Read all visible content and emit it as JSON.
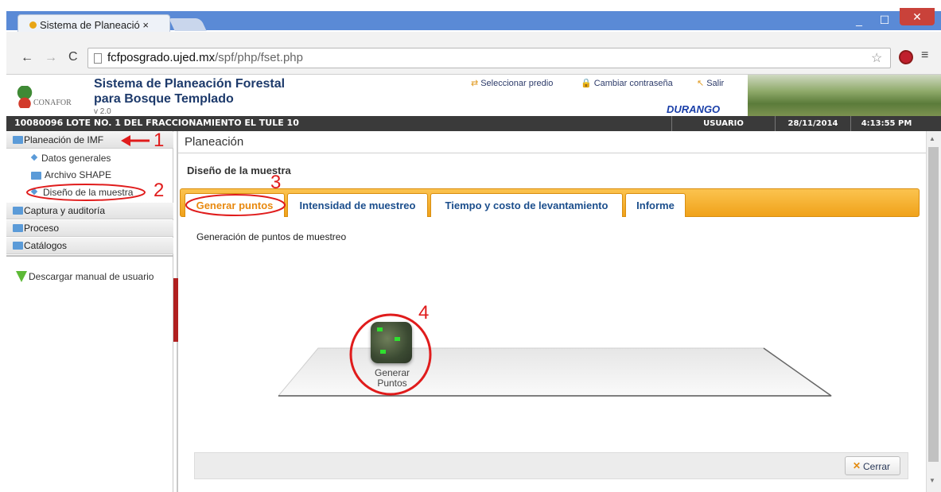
{
  "browser": {
    "tab_title": "Sistema de Planeació ×",
    "url_host": "fcfposgrado.ujed.mx",
    "url_path": "/spf/php/fset.php",
    "min_glyph": "_",
    "max_glyph": "☐",
    "close_glyph": "✕"
  },
  "app": {
    "title_line1": "Sistema de Planeación Forestal",
    "title_line2": "para Bosque Templado",
    "version": "v 2.0",
    "logo_text": "CONAFOR",
    "links": {
      "predio": "Seleccionar predio",
      "password": "Cambiar contraseña",
      "salir": "Salir"
    },
    "region": "DURANGO"
  },
  "status": {
    "predio": "10080096 LOTE NO. 1 DEL FRACCIONAMIENTO EL TULE 10",
    "user": "USUARIO",
    "date": "28/11/2014",
    "time": "4:13:55 PM"
  },
  "sidebar": {
    "planeacion": "Planeación de IMF",
    "items": [
      {
        "label": "Datos generales"
      },
      {
        "label": "Archivo SHAPE"
      },
      {
        "label": "Diseño de la muestra"
      }
    ],
    "captura": "Captura y auditoría",
    "proceso": "Proceso",
    "catalogos": "Catálogos",
    "download": "Descargar manual de usuario"
  },
  "main": {
    "header": "Planeación",
    "section_title": "Diseño de la muestra",
    "tabs": [
      {
        "label": "Generar puntos"
      },
      {
        "label": "Intensidad de muestreo"
      },
      {
        "label": "Tiempo y costo de levantamiento"
      },
      {
        "label": "Informe"
      }
    ],
    "panel_title": "Generación de puntos de muestreo",
    "gen_label_1": "Generar",
    "gen_label_2": "Puntos",
    "close_button": "Cerrar"
  },
  "annotations": {
    "n1": "1",
    "n2": "2",
    "n3": "3",
    "n4": "4"
  },
  "colors": {
    "titlebar": "#5a8ad6",
    "accent_orange": "#f0a21a",
    "annotation_red": "#e01c1c",
    "tab_text_blue": "#1b4e8c"
  }
}
